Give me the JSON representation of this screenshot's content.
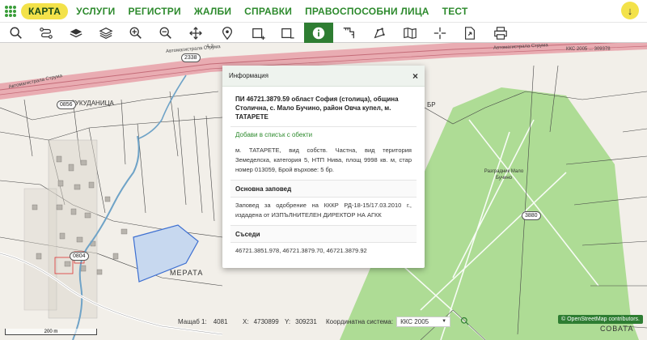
{
  "nav": {
    "items": [
      {
        "label": "КАРТА",
        "active": true
      },
      {
        "label": "УСЛУГИ",
        "active": false
      },
      {
        "label": "РЕГИСТРИ",
        "active": false
      },
      {
        "label": "ЖАЛБИ",
        "active": false
      },
      {
        "label": "СПРАВКИ",
        "active": false
      },
      {
        "label": "ПРАВОСПОСОБНИ ЛИЦА",
        "active": false
      },
      {
        "label": "ТЕСТ",
        "active": false
      }
    ]
  },
  "toolbar": {
    "tools": [
      {
        "icon": "search-icon"
      },
      {
        "icon": "route-icon"
      },
      {
        "icon": "layers-icon"
      },
      {
        "icon": "stack-icon"
      },
      {
        "icon": "zoom-in-icon"
      },
      {
        "icon": "zoom-out-icon"
      },
      {
        "icon": "pan-icon"
      },
      {
        "icon": "location-pin-icon"
      },
      {
        "icon": "select-rect-plus-icon"
      },
      {
        "icon": "select-rect-minus-icon"
      },
      {
        "icon": "info-icon",
        "active": true
      },
      {
        "icon": "measure-icon"
      },
      {
        "icon": "draw-icon"
      },
      {
        "icon": "book-icon"
      },
      {
        "icon": "crosshair-icon"
      },
      {
        "icon": "export-icon"
      },
      {
        "icon": "print-icon"
      }
    ]
  },
  "map": {
    "labels": {
      "kukudanitsa": "КУКУДАНИЦА",
      "merata": "МЕРАТА",
      "sovata": "СОВАТА",
      "razgradnik": "Разградник Мало Бучино",
      "br": "БР"
    },
    "parcel_numbers": [
      "2338",
      "0856",
      "3880",
      "0804"
    ],
    "road_labels": {
      "highway1": "Автомагистрала Струма",
      "highway2": "Автомагистрала Струма",
      "highway3": "Автомагистрала Струма",
      "a3": "А 3",
      "kks": "ККС 2005 ... 309378"
    }
  },
  "popup": {
    "title": "Информация",
    "close": "×",
    "parcel_title": "ПИ 46721.3879.59 област София (столица), община Столична, с. Мало Бучино, район Овча купел, м. ТАТАРЕТЕ",
    "add_link": "Добави в списък с обекти",
    "description": "м. ТАТАРЕТЕ, вид собств. Частна, вид територия Земеделска, категория 5, НТП Нива, площ 9998 кв. м, стар номер 013059, Брой върхове: 5 бр.",
    "order_header": "Основна заповед",
    "order_text": "Заповед за одобрение на КККР РД-18-15/17.03.2010 г., издадена от ИЗПЪЛНИТЕЛЕН ДИРЕКТОР НА АГКК",
    "neighbors_header": "Съседи",
    "neighbors_text": "46721.3851.978, 46721.3879.70, 46721.3879.92"
  },
  "status": {
    "scale_label": "Мащаб 1:",
    "scale_value": "4081",
    "x_label": "X:",
    "x_value": "4730899",
    "y_label": "Y:",
    "y_value": "309231",
    "crs_label": "Координатна система:",
    "crs_value": "ККС 2005",
    "scale_bar": "200 m",
    "osm": "© OpenStreetMap contributors."
  },
  "colors": {
    "accent": "#2e7d32",
    "nav_text": "#2d8a2d",
    "active_nav": "#f3e24a",
    "highway": "#e8a0a8",
    "green_area": "#a6d98c",
    "selected_parcel": "#c7d8ef"
  }
}
